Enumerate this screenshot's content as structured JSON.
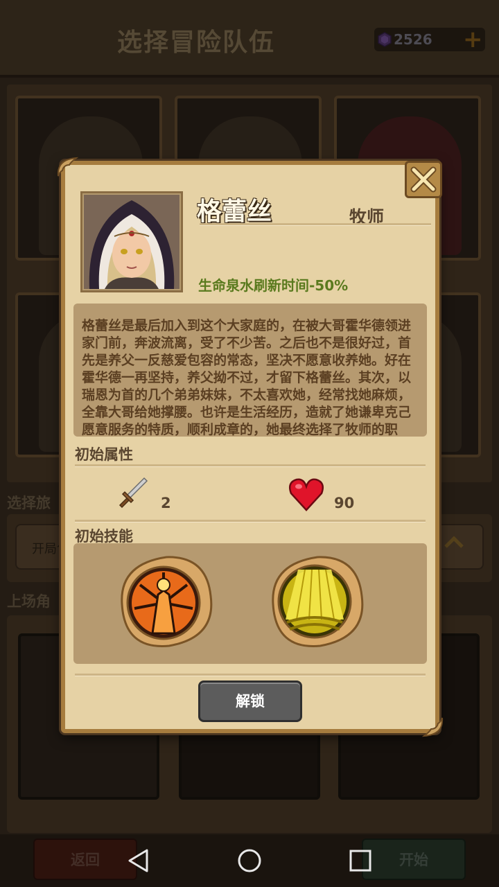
{
  "screen": {
    "title": "选择冒险队伍",
    "gems": "2526",
    "section_path": "选择旅",
    "path_option": "开局包",
    "section_heroes": "上场角",
    "back_label": "返回",
    "start_label": "开始"
  },
  "hero": {
    "name": "格蕾丝",
    "class": "牧师",
    "perk": "生命泉水刷新时间-50%",
    "description": "格蕾丝是最后加入到这个大家庭的，在被大哥霍华德领进家门前，奔波流离，受了不少苦。之后也不是很好过，首先是养父一反慈爱包容的常态，坚决不愿意收养她。好在霍华德一再坚持，养父拗不过，才留下格蕾丝。其次，以瑞恩为首的几个弟弟妹妹，不太喜欢她，经常找她麻烦，全靠大哥给她撑腰。也许是生活经历，造就了她谦卑克己愿意服务的特质，顺利成章的，她最终选择了牧师的职业。",
    "attributes_label": "初始属性",
    "attack": "2",
    "health": "90",
    "skills_label": "初始技能",
    "skills": [
      "praying-hands-skill",
      "golden-light-skill"
    ],
    "unlock_label": "解锁"
  },
  "colors": {
    "modal_bg": "#e6d2a5",
    "frame": "#a67c3e",
    "perk": "#5a7a1e",
    "name_outline": "#3a2a18"
  }
}
